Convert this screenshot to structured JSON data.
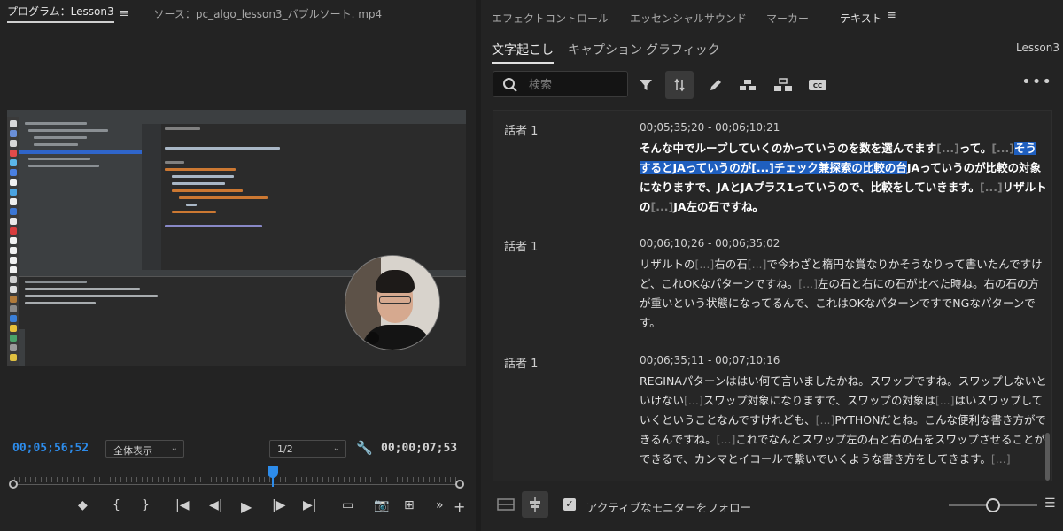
{
  "program": {
    "tab_label": "プログラム：Lesson3",
    "menu_glyph": "≡",
    "source_label": "ソース：pc_algo_lesson3_バブルソート. mp4",
    "timecode_current": "00;05;56;52",
    "zoom_value": "全体表示",
    "resolution_value": "1/2",
    "timecode_duration": "00;00;07;53",
    "playhead_fraction": 0.58,
    "transport": [
      "◆",
      "{",
      "}",
      "|◀",
      "◀|",
      "▶",
      "|▶",
      "▶|",
      "▭",
      "📷",
      "⊞",
      "»",
      "+"
    ]
  },
  "panel": {
    "tabs": [
      {
        "label": "エフェクトコントロール",
        "active": false
      },
      {
        "label": "エッセンシャルサウンド",
        "active": false
      },
      {
        "label": "マーカー",
        "active": false
      },
      {
        "label": "テキスト",
        "active": true
      }
    ],
    "menu_glyph": "≡",
    "subtabs": [
      {
        "label": "文字起こし",
        "active": true
      },
      {
        "label": "キャプション",
        "active": false
      },
      {
        "label": "グラフィック",
        "active": false
      }
    ],
    "sequence_name": "Lesson3",
    "search_placeholder": "検索",
    "more_glyph": "•••",
    "follow_monitor_label": "アクティブなモニターをフォロー",
    "follow_monitor_checked": true,
    "accent_color": "#2d8ceb",
    "highlight_color": "#1f5fbf"
  },
  "transcript": [
    {
      "speaker": "話者 1",
      "time": "00;05;35;20 - 00;06;10;21",
      "current": true,
      "parts": [
        {
          "t": "そんな中でループしていくのかっていうのを数を選んでます",
          "c": ""
        },
        {
          "t": "[...]",
          "c": "dim"
        },
        {
          "t": "って。",
          "c": ""
        },
        {
          "t": "[...]",
          "c": "dim"
        },
        {
          "t": "そうするとJAっていうのが",
          "c": "hl"
        },
        {
          "t": "[...]",
          "c": "hl"
        },
        {
          "t": "チェック兼探索の比較の台",
          "c": "hl"
        },
        {
          "t": "JAっていうのが比較の対象になりますで、JAとJAプラス1っていうので、比較をしていきます。",
          "c": ""
        },
        {
          "t": "[...]",
          "c": "dim"
        },
        {
          "t": "リザルトの",
          "c": ""
        },
        {
          "t": "[...]",
          "c": "dim"
        },
        {
          "t": "JA左の石ですね。",
          "c": ""
        }
      ]
    },
    {
      "speaker": "話者 1",
      "time": "00;06;10;26 - 00;06;35;02",
      "current": false,
      "parts": [
        {
          "t": "リザルトの",
          "c": ""
        },
        {
          "t": "[...]",
          "c": "dim"
        },
        {
          "t": "右の石",
          "c": ""
        },
        {
          "t": "[...]",
          "c": "dim"
        },
        {
          "t": "で今わざと楕円な賞なりかそうなりって書いたんですけど、これOKなパターンですね。",
          "c": ""
        },
        {
          "t": "[...]",
          "c": "dim"
        },
        {
          "t": "左の石と右にの石が比べた時ね。右の石の方が重いという状態になってるんで、これはOKなパターンですでNGなパターンです。",
          "c": ""
        }
      ]
    },
    {
      "speaker": "話者 1",
      "time": "00;06;35;11 - 00;07;10;16",
      "current": false,
      "parts": [
        {
          "t": "REGINAパターンははい何て言いましたかね。スワップですね。スワップしないといけない",
          "c": ""
        },
        {
          "t": "[...]",
          "c": "dim"
        },
        {
          "t": "スワップ対象になりますで、スワップの対象は",
          "c": ""
        },
        {
          "t": "[...]",
          "c": "dim"
        },
        {
          "t": "はいスワップしていくということなんですけれども、",
          "c": ""
        },
        {
          "t": "[...]",
          "c": "dim"
        },
        {
          "t": "PYTHONだとね。こんな便利な書き方ができるんですね。",
          "c": ""
        },
        {
          "t": "[...]",
          "c": "dim"
        },
        {
          "t": "これでなんとスワップ左の石と右の石をスワップさせることができるで、カンマとイコールで繋いでいくような書き方をしてきます。",
          "c": ""
        },
        {
          "t": "[...]",
          "c": "dim"
        }
      ]
    }
  ]
}
